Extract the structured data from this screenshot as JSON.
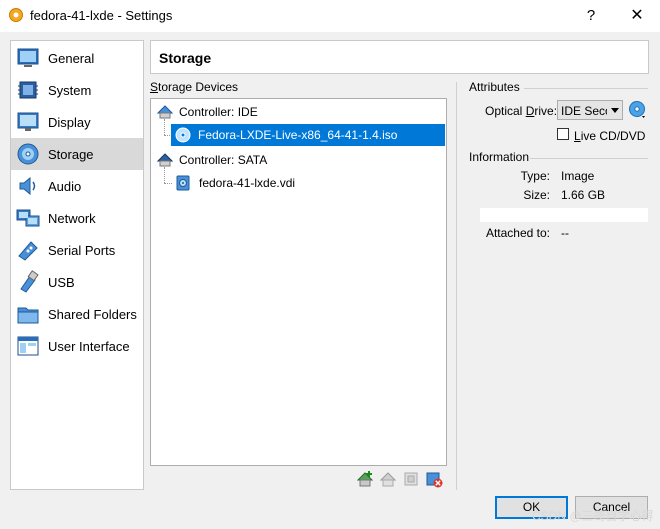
{
  "window": {
    "title": "fedora-41-lxde - Settings",
    "help_label": "?",
    "close_label": "✕"
  },
  "sidebar": {
    "items": [
      {
        "label": "General",
        "icon": "general-icon"
      },
      {
        "label": "System",
        "icon": "system-icon"
      },
      {
        "label": "Display",
        "icon": "display-icon"
      },
      {
        "label": "Storage",
        "icon": "storage-icon",
        "selected": true
      },
      {
        "label": "Audio",
        "icon": "audio-icon"
      },
      {
        "label": "Network",
        "icon": "network-icon"
      },
      {
        "label": "Serial Ports",
        "icon": "serial-ports-icon"
      },
      {
        "label": "USB",
        "icon": "usb-icon"
      },
      {
        "label": "Shared Folders",
        "icon": "shared-folders-icon"
      },
      {
        "label": "User Interface",
        "icon": "user-interface-icon"
      }
    ]
  },
  "header": {
    "title": "Storage"
  },
  "storage": {
    "label_pre": "",
    "label_accel": "S",
    "label_post": "torage Devices",
    "controllers": [
      {
        "label": "Controller: IDE",
        "devices": [
          {
            "label": "Fedora-LXDE-Live-x86_64-41-1.4.iso",
            "type": "optical",
            "selected": true
          }
        ]
      },
      {
        "label": "Controller: SATA",
        "devices": [
          {
            "label": "fedora-41-lxde.vdi",
            "type": "disk",
            "selected": false
          }
        ]
      }
    ],
    "toolbar": [
      "add-attachment-icon",
      "remove-attachment-icon",
      "add-controller-icon",
      "remove-controller-icon"
    ]
  },
  "attributes": {
    "section_title": "Attributes",
    "optical_drive_pre": "Optical ",
    "optical_drive_accel": "D",
    "optical_drive_post": "rive:",
    "optical_drive_value": "IDE Secondary",
    "live_cd_accel": "L",
    "live_cd_post": "ive CD/DVD",
    "live_cd_checked": false
  },
  "information": {
    "section_title": "Information",
    "type_label": "Type:",
    "type_value": "Image",
    "size_label": "Size:",
    "size_value": "1.66 GB",
    "attached_label": "Attached to:",
    "attached_value": "--"
  },
  "buttons": {
    "ok": "OK",
    "cancel": "Cancel"
  },
  "watermark": "CSDN @三哥自学心得"
}
